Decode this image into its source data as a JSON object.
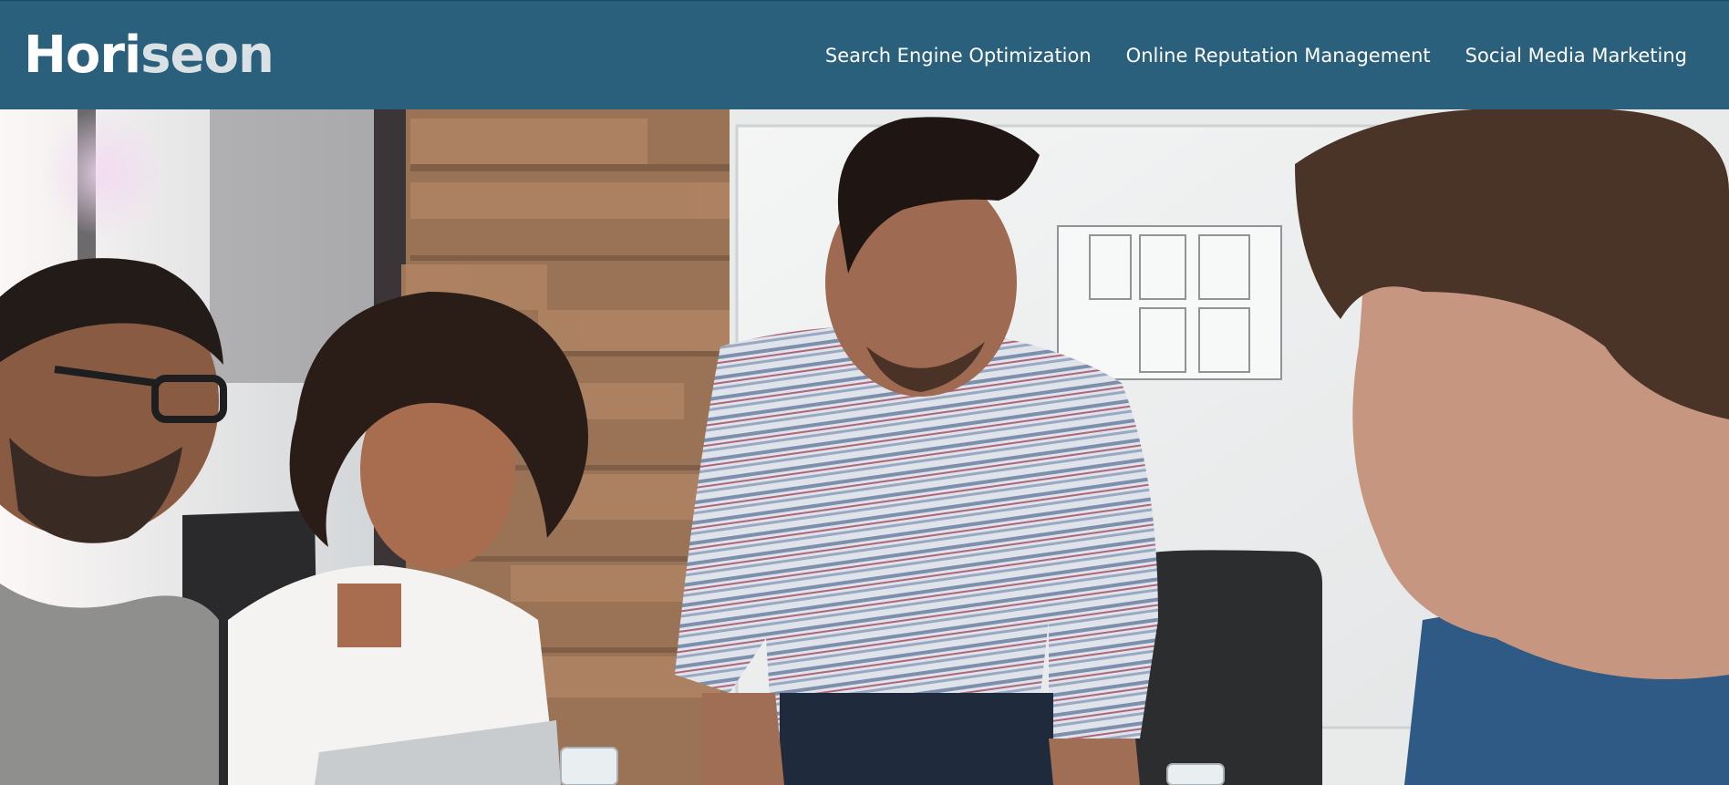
{
  "logo": {
    "part1": "Hori",
    "part2": "seon"
  },
  "nav": {
    "items": [
      {
        "label": "Search Engine Optimization"
      },
      {
        "label": "Online Reputation Management"
      },
      {
        "label": "Social Media Marketing"
      }
    ]
  },
  "colors": {
    "header_bg": "#2a607c",
    "nav_text": "#ffffff",
    "logo_primary": "#ffffff",
    "logo_secondary": "#d9e1e4"
  },
  "hero": {
    "icon": "team-meeting-photo"
  }
}
